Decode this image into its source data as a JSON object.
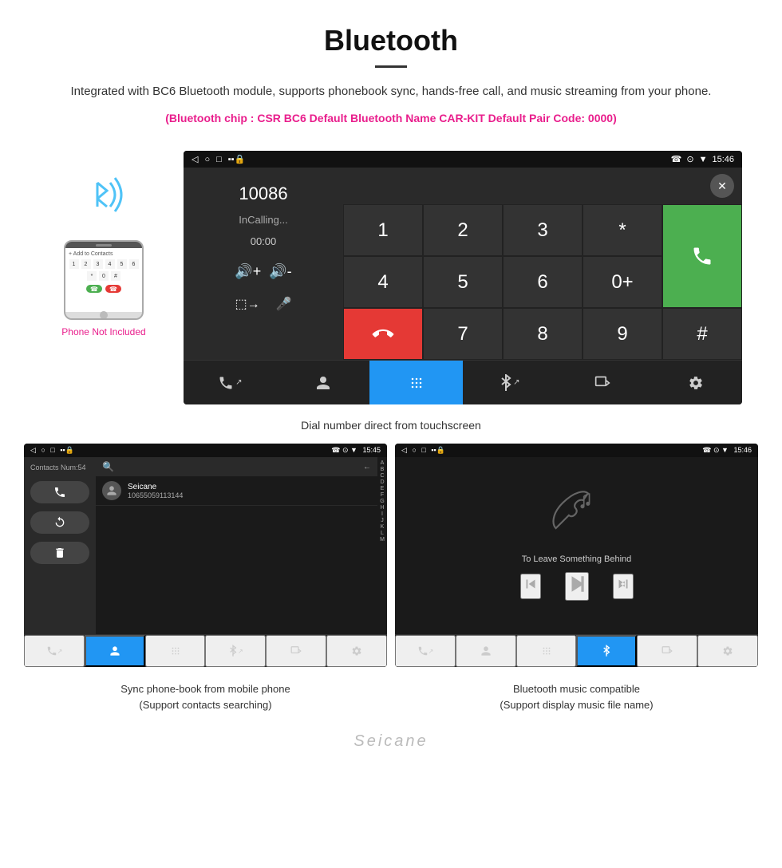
{
  "header": {
    "title": "Bluetooth",
    "description": "Integrated with BC6 Bluetooth module, supports phonebook sync, hands-free call, and music streaming from your phone.",
    "specs": "(Bluetooth chip : CSR BC6    Default Bluetooth Name CAR-KIT    Default Pair Code: 0000)"
  },
  "dial_screen": {
    "status_bar": {
      "left_icons": [
        "◁",
        "○",
        "□",
        "⬛🔒"
      ],
      "right_icons": [
        "☎",
        "⊙",
        "▼",
        "15:46"
      ]
    },
    "number": "10086",
    "status": "InCalling...",
    "timer": "00:00",
    "keys": [
      "1",
      "2",
      "3",
      "*",
      "4",
      "5",
      "6",
      "0+",
      "7",
      "8",
      "9",
      "#"
    ],
    "call_label": "☎",
    "hangup_label": "☎",
    "nav_items": [
      "↗☎",
      "👤",
      "⠿",
      "✱",
      "⬚→",
      "⚙"
    ]
  },
  "caption_main": "Dial number direct from touchscreen",
  "phone_side": {
    "not_included": "Phone Not Included"
  },
  "contacts_screen": {
    "status_bar": {
      "time": "15:45"
    },
    "contacts_num": "Contacts Num:54",
    "search_placeholder": "",
    "contact": {
      "name": "Seicane",
      "number": "10655059113144"
    },
    "alpha_list": [
      "A",
      "B",
      "C",
      "D",
      "E",
      "F",
      "G",
      "H",
      "I",
      "J",
      "K",
      "L",
      "M"
    ],
    "nav_items": [
      "↗☎",
      "👤",
      "⠿",
      "✱",
      "⬚→",
      "⚙"
    ]
  },
  "music_screen": {
    "status_bar": {
      "time": "15:46"
    },
    "song_title": "To Leave Something Behind",
    "nav_items": [
      "↗☎",
      "👤",
      "⠿",
      "✱",
      "⬚→",
      "⚙"
    ]
  },
  "bottom_captions": {
    "left": "Sync phone-book from mobile phone\n(Support contacts searching)",
    "right": "Bluetooth music compatible\n(Support display music file name)"
  },
  "watermark": "Seicane"
}
